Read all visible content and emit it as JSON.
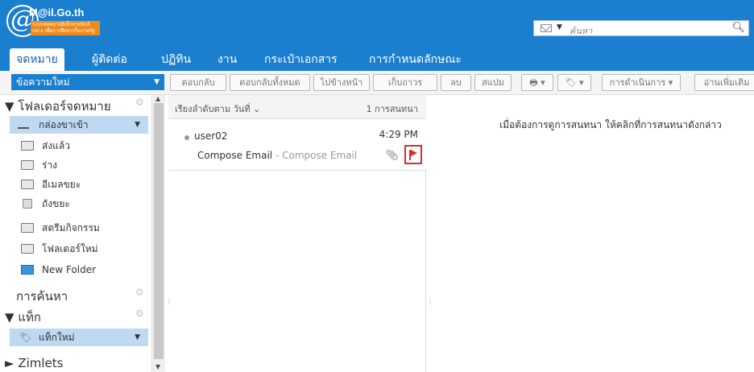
{
  "header": {
    "logo_text": "M@il.Go.th",
    "logo_sub": "ระบบจดหมายอิเล็กทรอนิกส์กลาง เพื่อการสื่อสารในภาครัฐ",
    "search_placeholder": "ค้นหา"
  },
  "tabs": [
    {
      "label": "จดหมาย",
      "active": true
    },
    {
      "label": "ผู้ติดต่อ"
    },
    {
      "label": "ปฏิทิน"
    },
    {
      "label": "งาน"
    },
    {
      "label": "กระเป๋าเอกสาร"
    },
    {
      "label": "การกำหนดลักษณะ"
    }
  ],
  "toolbar": {
    "new_message": "ข้อความใหม่",
    "buttons": [
      "ตอบกลับ",
      "ตอบกลับทั้งหมด",
      "ไปข้างหน้า",
      "เก็บถาวร",
      "ลบ",
      "สแปม",
      "การดำเนินการ",
      "อ่านเพิ่มเติม"
    ]
  },
  "nav": {
    "folders_header": "โฟลเดอร์จดหมาย",
    "folders": [
      {
        "label": "กล่องขาเข้า",
        "icon": "inbox-icon",
        "selected": true
      },
      {
        "label": "ส่งแล้ว",
        "icon": "sent-icon"
      },
      {
        "label": "ร่าง",
        "icon": "drafts-icon"
      },
      {
        "label": "อีเมลขยะ",
        "icon": "junk-icon"
      },
      {
        "label": "ถังขยะ",
        "icon": "trash-icon"
      },
      {
        "label": "สตรีมกิจกรรม",
        "icon": "folder-icon"
      },
      {
        "label": "โฟลเดอร์ใหม่",
        "icon": "folder-icon"
      },
      {
        "label": "New Folder",
        "icon": "blue-folder-icon"
      }
    ],
    "search_header": "การค้นหา",
    "tags_header": "แท็ก",
    "tags": [
      {
        "label": "แท็กใหม่",
        "selected": true
      }
    ],
    "zimlets_header": "Zimlets"
  },
  "list": {
    "sort_label": "เรียงลำดับตาม วันที่",
    "count_label": "1 การสนทนา",
    "items": [
      {
        "sender": "user02",
        "time": "4:29 PM",
        "subject": "Compose Email",
        "fragment": "Compose Email",
        "flagged": true,
        "attachment": true
      }
    ]
  },
  "reading": {
    "hint": "เมื่อต้องการดูการสนทนา ให้คลิกที่การสนทนาดังกล่าว"
  }
}
